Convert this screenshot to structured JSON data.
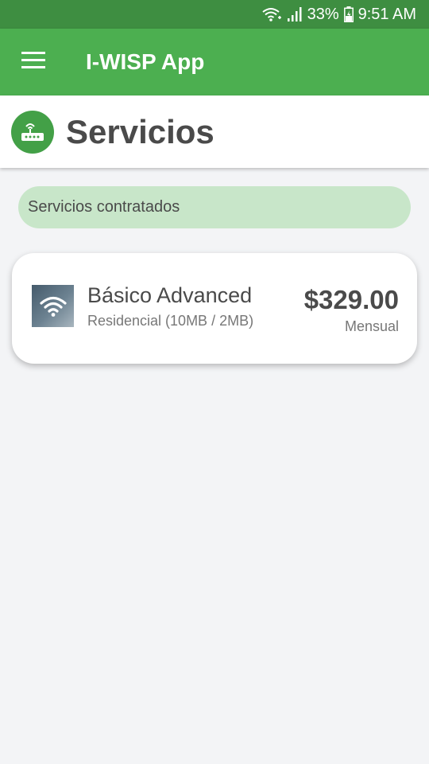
{
  "status_bar": {
    "battery_percent": "33%",
    "time": "9:51 AM",
    "icons": [
      "wifi-icon",
      "signal-icon",
      "battery-icon"
    ]
  },
  "app_bar": {
    "title": "I-WISP App",
    "menu_icon": "hamburger-menu-icon"
  },
  "header": {
    "title": "Servicios",
    "icon": "router-icon"
  },
  "section": {
    "label": "Servicios contratados"
  },
  "services": [
    {
      "name": "Básico Advanced",
      "description": "Residencial (10MB / 2MB)",
      "price": "$329.00",
      "period": "Mensual",
      "icon": "wifi-icon"
    }
  ],
  "colors": {
    "status_bar": "#3e8e41",
    "app_bar": "#4caf50",
    "header_icon_bg": "#43a047",
    "section_pill": "#c8e6c9",
    "background": "#f3f4f6"
  }
}
